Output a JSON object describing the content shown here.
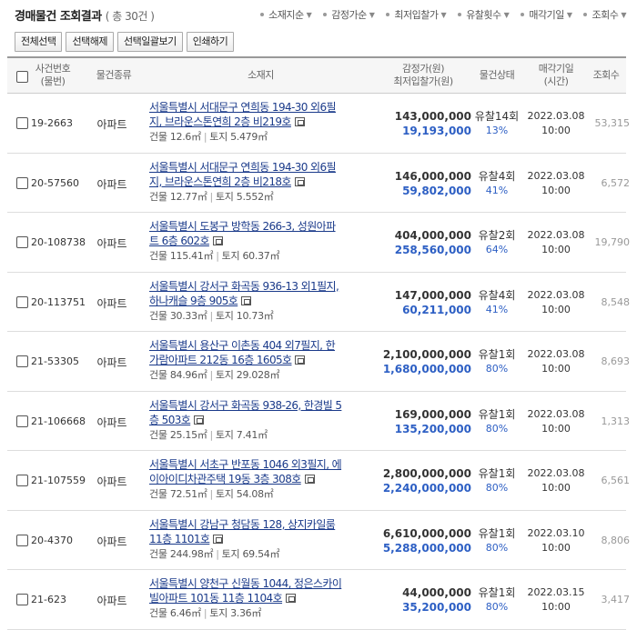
{
  "header": {
    "title": "경매물건 조회결과",
    "count": "( 총 30건 )",
    "sorts": [
      "소재지순",
      "감정가순",
      "최저입찰가",
      "유찰횟수",
      "매각기일",
      "조회수"
    ]
  },
  "buttons": {
    "select_all": "전체선택",
    "deselect": "선택해제",
    "view_selected": "선택일괄보기",
    "print": "인쇄하기"
  },
  "columns": {
    "case_l1": "사건번호",
    "case_l2": "(물번)",
    "type": "물건종류",
    "location": "소재지",
    "price_l1": "감정가(원)",
    "price_l2": "최저입찰가(원)",
    "status": "물건상태",
    "date_l1": "매각기일",
    "date_l2": "(시간)",
    "views": "조회수"
  },
  "rows": [
    {
      "case": "19-2663",
      "type": "아파트",
      "addr1": "서울특별시 서대문구 연희동 194-30 외6필",
      "addr2": "지, 브라운스톤연희 2층 비219호",
      "bldg": "건물 12.6㎡",
      "land": "토지 5.479㎡",
      "appraisal": "143,000,000",
      "min": "19,193,000",
      "fail": "유찰14회",
      "pct": "13%",
      "date": "2022.03.08",
      "time": "10:00",
      "views": "53,315"
    },
    {
      "case": "20-57560",
      "type": "아파트",
      "addr1": "서울특별시 서대문구 연희동 194-30 외6필",
      "addr2": "지, 브라운스톤연희 2층 비218호",
      "bldg": "건물 12.77㎡",
      "land": "토지 5.552㎡",
      "appraisal": "146,000,000",
      "min": "59,802,000",
      "fail": "유찰4회",
      "pct": "41%",
      "date": "2022.03.08",
      "time": "10:00",
      "views": "6,572"
    },
    {
      "case": "20-108738",
      "type": "아파트",
      "addr1": "서울특별시 도봉구 방학동 266-3, 성원아파",
      "addr2": "트 6층 602호",
      "bldg": "건물 115.41㎡",
      "land": "토지 60.37㎡",
      "appraisal": "404,000,000",
      "min": "258,560,000",
      "fail": "유찰2회",
      "pct": "64%",
      "date": "2022.03.08",
      "time": "10:00",
      "views": "19,790"
    },
    {
      "case": "20-113751",
      "type": "아파트",
      "addr1": "서울특별시 강서구 화곡동 936-13 외1필지,",
      "addr2": "하나캐슬 9층 905호",
      "bldg": "건물 30.33㎡",
      "land": "토지 10.73㎡",
      "appraisal": "147,000,000",
      "min": "60,211,000",
      "fail": "유찰4회",
      "pct": "41%",
      "date": "2022.03.08",
      "time": "10:00",
      "views": "8,548"
    },
    {
      "case": "21-53305",
      "type": "아파트",
      "addr1": "서울특별시 용산구 이촌동 404 외7필지, 한",
      "addr2": "가람아파트 212동 16층 1605호",
      "bldg": "건물 84.96㎡",
      "land": "토지 29.028㎡",
      "appraisal": "2,100,000,000",
      "min": "1,680,000,000",
      "fail": "유찰1회",
      "pct": "80%",
      "date": "2022.03.08",
      "time": "10:00",
      "views": "8,693"
    },
    {
      "case": "21-106668",
      "type": "아파트",
      "addr1": "서울특별시 강서구 화곡동 938-26, 한경빌 5",
      "addr2": "층 503호",
      "bldg": "건물 25.15㎡",
      "land": "토지 7.41㎡",
      "appraisal": "169,000,000",
      "min": "135,200,000",
      "fail": "유찰1회",
      "pct": "80%",
      "date": "2022.03.08",
      "time": "10:00",
      "views": "1,313"
    },
    {
      "case": "21-107559",
      "type": "아파트",
      "addr1": "서울특별시 서초구 반포동 1046 외3필지, 에",
      "addr2": "이아이디차관주택 19동 3층 308호",
      "bldg": "건물 72.51㎡",
      "land": "토지 54.08㎡",
      "appraisal": "2,800,000,000",
      "min": "2,240,000,000",
      "fail": "유찰1회",
      "pct": "80%",
      "date": "2022.03.08",
      "time": "10:00",
      "views": "6,561"
    },
    {
      "case": "20-4370",
      "type": "아파트",
      "addr1": "서울특별시 강남구 청담동 128, 상지카일룸",
      "addr2": "11층 1101호",
      "bldg": "건물 244.98㎡",
      "land": "토지 69.54㎡",
      "appraisal": "6,610,000,000",
      "min": "5,288,000,000",
      "fail": "유찰1회",
      "pct": "80%",
      "date": "2022.03.10",
      "time": "10:00",
      "views": "8,806"
    },
    {
      "case": "21-623",
      "type": "아파트",
      "addr1": "서울특별시 양천구 신월동 1044, 정은스카이",
      "addr2": "빌아파트 101동 11층 1104호",
      "bldg": "건물 6.46㎡",
      "land": "토지 3.36㎡",
      "appraisal": "44,000,000",
      "min": "35,200,000",
      "fail": "유찰1회",
      "pct": "80%",
      "date": "2022.03.15",
      "time": "10:00",
      "views": "3,417"
    }
  ]
}
